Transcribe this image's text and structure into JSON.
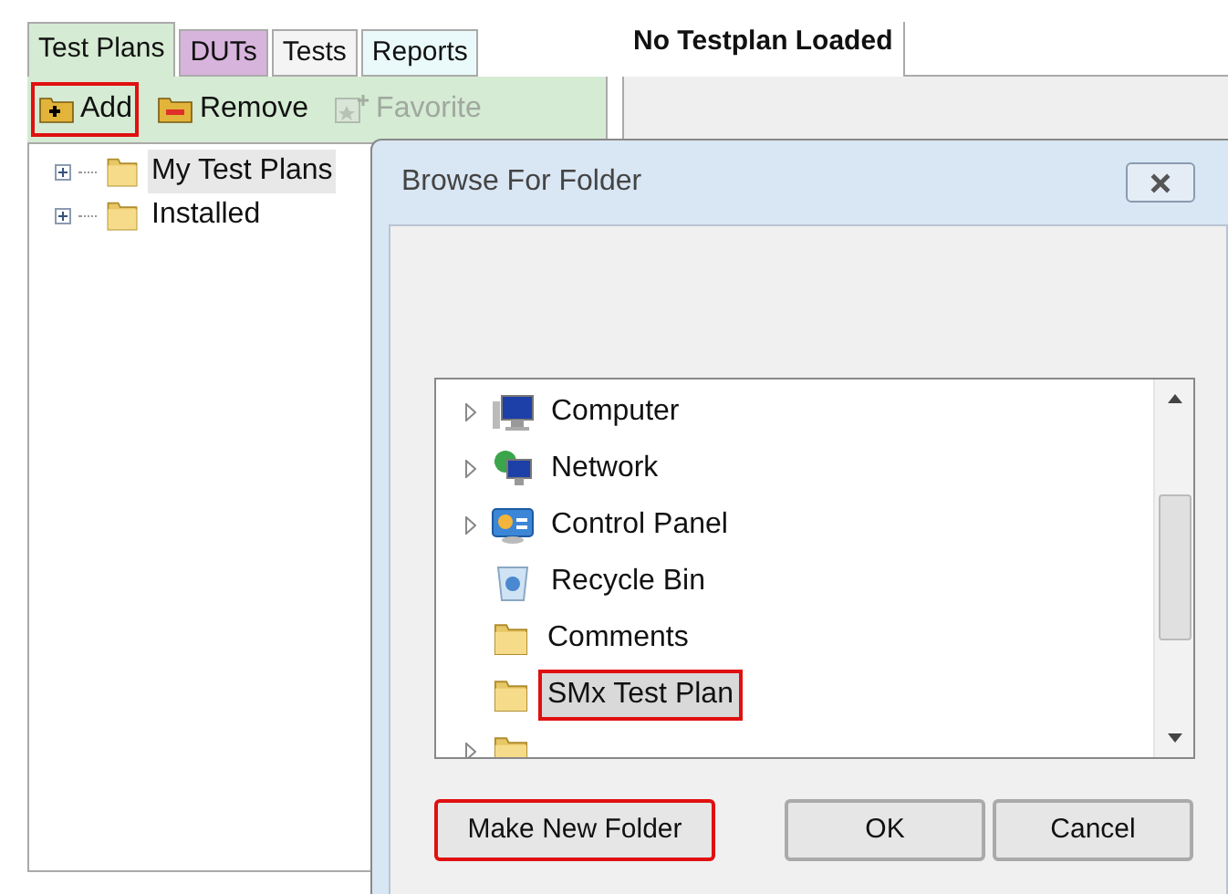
{
  "left_tabs": [
    {
      "label": "Test Plans",
      "selected": true,
      "color": "#d5ebd3"
    },
    {
      "label": "DUTs",
      "selected": false,
      "color": "#d7b4dc"
    },
    {
      "label": "Tests",
      "selected": false,
      "color": "#f4f4f4"
    },
    {
      "label": "Reports",
      "selected": false,
      "color": "#eafafa"
    }
  ],
  "toolbar": [
    {
      "label": "Add",
      "kind": "add",
      "disabled": false,
      "annotated": true
    },
    {
      "label": "Remove",
      "kind": "remove",
      "disabled": false,
      "annotated": false
    },
    {
      "label": "Favorite",
      "kind": "favorite",
      "disabled": true,
      "annotated": false
    }
  ],
  "plan_tree": [
    {
      "label": "My Test Plans",
      "selected": true,
      "expanded": false
    },
    {
      "label": "Installed",
      "selected": false,
      "expanded": false
    }
  ],
  "document_tab": {
    "label": "No Testplan Loaded",
    "selected": true
  },
  "dialog": {
    "title": "Browse For Folder",
    "folders": [
      {
        "label": "Computer",
        "kind": "computer",
        "expandable": true,
        "selected": false,
        "annotated": false
      },
      {
        "label": "Network",
        "kind": "network",
        "expandable": true,
        "selected": false,
        "annotated": false
      },
      {
        "label": "Control Panel",
        "kind": "control-panel",
        "expandable": true,
        "selected": false,
        "annotated": false
      },
      {
        "label": "Recycle Bin",
        "kind": "recycle-bin",
        "expandable": false,
        "selected": false,
        "annotated": false
      },
      {
        "label": "Comments",
        "kind": "folder",
        "expandable": false,
        "selected": false,
        "annotated": false
      },
      {
        "label": "SMx Test Plan",
        "kind": "folder",
        "expandable": false,
        "selected": true,
        "annotated": true
      },
      {
        "kind": "folder-cut",
        "expandable": true
      }
    ],
    "buttons": [
      {
        "label": "Make New Folder",
        "annotated": true
      },
      {
        "label": "OK",
        "annotated": false
      },
      {
        "label": "Cancel",
        "annotated": false
      }
    ]
  }
}
